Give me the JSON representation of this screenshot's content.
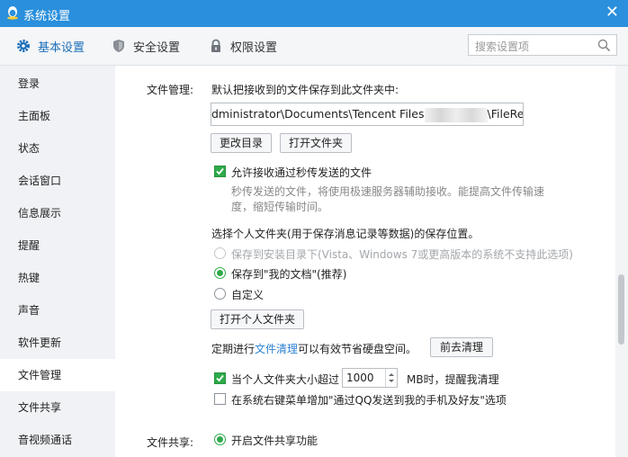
{
  "window": {
    "title": "系统设置",
    "close": "✕"
  },
  "tabs": [
    {
      "label": "基本设置",
      "icon": "gear-icon",
      "active": true
    },
    {
      "label": "安全设置",
      "icon": "shield-icon"
    },
    {
      "label": "权限设置",
      "icon": "lock-icon"
    }
  ],
  "search": {
    "placeholder": "搜索设置项"
  },
  "sidebar": {
    "items": [
      {
        "label": "登录"
      },
      {
        "label": "主面板"
      },
      {
        "label": "状态"
      },
      {
        "label": "会话窗口"
      },
      {
        "label": "信息展示"
      },
      {
        "label": "提醒"
      },
      {
        "label": "热键"
      },
      {
        "label": "声音"
      },
      {
        "label": "软件更新"
      },
      {
        "label": "文件管理",
        "active": true
      },
      {
        "label": "文件共享"
      },
      {
        "label": "音视频通话"
      }
    ]
  },
  "file_mgmt": {
    "section_label": "文件管理:",
    "save_desc": "默认把接收到的文件保存到此文件夹中:",
    "path_prefix": "dministrator\\Documents\\Tencent Files",
    "path_suffix": "\\FileRecv\\",
    "change_dir": "更改目录",
    "open_folder": "打开文件夹",
    "allow_instant": "允许接收通过秒传发送的文件",
    "instant_desc_1": "秒传发送的文件，将使用极速服务器辅助接收。能提高文件传输速",
    "instant_desc_2": "度，缩短传输时间。",
    "personal_title": "选择个人文件夹(用于保存消息记录等数据)的保存位置。",
    "opt_install": "保存到安装目录下(Vista、Windows 7或更高版本的系统不支持此选项)",
    "opt_mydocs": "保存到\"我的文档\"(推荐)",
    "opt_custom": "自定义",
    "open_personal": "打开个人文件夹",
    "cleanup_pre": "定期进行",
    "cleanup_link": "文件清理",
    "cleanup_post": "可以有效节省硬盘空间。",
    "goto_cleanup": "前去清理",
    "size_pre": "当个人文件夹大小超过",
    "size_value": "1000",
    "size_post": "MB时，提醒我清理",
    "context_menu": "在系统右键菜单增加\"通过QQ发送到我的手机及好友\"选项"
  },
  "file_share": {
    "section_label": "文件共享:",
    "enable": "开启文件共享功能"
  },
  "colors": {
    "titlebar": "#2a8fdc",
    "accent": "#2faa4a",
    "link": "#2a7fcf"
  }
}
